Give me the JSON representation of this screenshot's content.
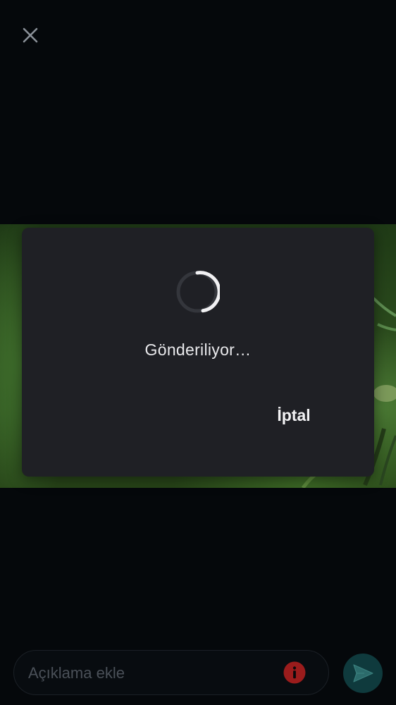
{
  "dialog": {
    "status_text": "Gönderiliyor…",
    "cancel_label": "İptal"
  },
  "caption": {
    "placeholder": "Açıklama ekle"
  },
  "icons": {
    "close": "close-icon",
    "spinner": "progress-spinner",
    "info": "info-icon",
    "send": "send-icon"
  },
  "colors": {
    "background": "#05080b",
    "dialog": "#1f2025",
    "info_badge": "#9b1c1c",
    "send_button": "#0f3a3d"
  }
}
